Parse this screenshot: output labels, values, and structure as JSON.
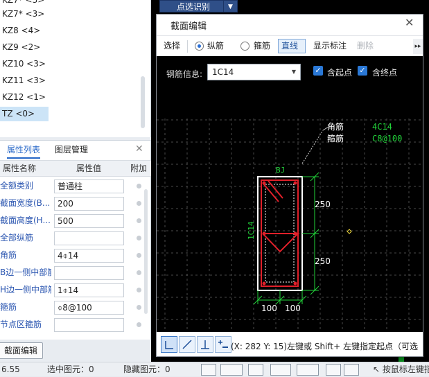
{
  "components": {
    "items": [
      "KZ7* <3>",
      "KZ8 <4>",
      "KZ9 <2>",
      "KZ10 <3>",
      "KZ11 <3>",
      "KZ12 <1>",
      "TZ <0>"
    ],
    "selected": "TZ <0>"
  },
  "property_panel": {
    "tabs": [
      "属性列表",
      "图层管理"
    ],
    "active_tab": "属性列表",
    "headers": [
      "属性名称",
      "属性值",
      "附加"
    ],
    "rows": [
      {
        "name": "全额类别",
        "value": "普通柱"
      },
      {
        "name": "截面宽度(B...",
        "value": "200"
      },
      {
        "name": "截面高度(H...",
        "value": "500"
      },
      {
        "name": "全部纵筋",
        "value": ""
      },
      {
        "name": "角筋",
        "value": "4⌽14"
      },
      {
        "name": "B边一侧中部筋",
        "value": ""
      },
      {
        "name": "H边一侧中部筋",
        "value": "1⌽14"
      },
      {
        "name": "箍筋",
        "value": "⌽8@100"
      },
      {
        "name": "节点区箍筋",
        "value": ""
      }
    ]
  },
  "section_edit_button": "截面编辑",
  "top_button": {
    "label": "点选识别"
  },
  "dialog": {
    "title": "截面编辑",
    "toolbar": {
      "select": "选择",
      "radio_longitudinal": "纵筋",
      "radio_stirrup": "箍筋",
      "line_mode": "直线",
      "show_dims": "显示标注",
      "delete": "删除"
    },
    "rebar_info_label": "钢筋信息:",
    "rebar_info_value": "1C14",
    "include_start": "含起点",
    "include_end": "含终点",
    "drawing": {
      "corner_label": "角筋",
      "corner_value": "4C14",
      "stirrup_label": "箍筋",
      "stirrup_value": "C8@100",
      "bj": "BJ",
      "side_label": "1C14",
      "dim_top": "250",
      "dim_bottom": "250",
      "dim_left": "100",
      "dim_right": "100"
    },
    "coord_text": "(X: 282 Y: 15)左键或 Shift+ 左键指定起点（可选"
  },
  "status_bar": {
    "left": "6.55",
    "selected": "选中图元：0",
    "hidden": "隐藏图元：0",
    "hint": "按鼠标左键指"
  },
  "colors": {
    "accent": "#2566c7",
    "canvas": "#000000",
    "rebar_red": "#e0202a",
    "dim_green": "#22d33a",
    "label_white": "#ffffff"
  }
}
